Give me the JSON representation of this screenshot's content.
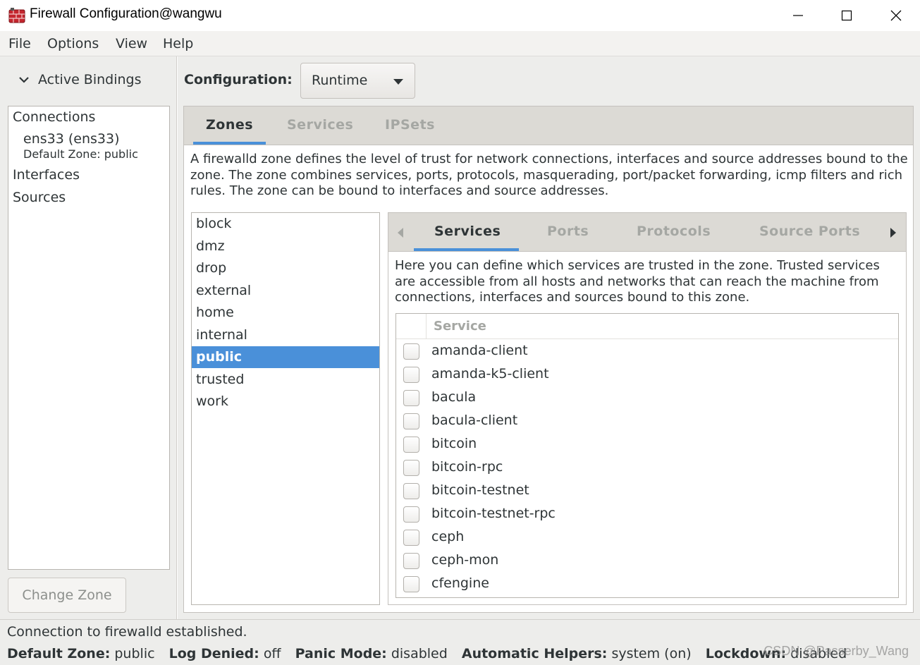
{
  "window": {
    "title": "Firewall Configuration@wangwu"
  },
  "menu": [
    "File",
    "Options",
    "View",
    "Help"
  ],
  "left": {
    "header": "Active Bindings",
    "connections_label": "Connections",
    "connection_name": "ens33 (ens33)",
    "connection_zone": "Default Zone: public",
    "interfaces_label": "Interfaces",
    "sources_label": "Sources",
    "change_zone_label": "Change Zone"
  },
  "config": {
    "label": "Configuration:",
    "value": "Runtime"
  },
  "tabs": [
    "Zones",
    "Services",
    "IPSets"
  ],
  "zone_description": "A firewalld zone defines the level of trust for network connections, interfaces and source addresses bound to the zone. The zone combines services, ports, protocols, masquerading, port/packet forwarding, icmp filters and rich rules. The zone can be bound to interfaces and source addresses.",
  "zones": [
    "block",
    "dmz",
    "drop",
    "external",
    "home",
    "internal",
    "public",
    "trusted",
    "work"
  ],
  "selected_zone": "public",
  "inner_tabs": [
    "Services",
    "Ports",
    "Protocols",
    "Source Ports"
  ],
  "services_description": "Here you can define which services are trusted in the zone. Trusted services are accessible from all hosts and networks that can reach the machine from connections, interfaces and sources bound to this zone.",
  "service_column": "Service",
  "services": [
    "amanda-client",
    "amanda-k5-client",
    "bacula",
    "bacula-client",
    "bitcoin",
    "bitcoin-rpc",
    "bitcoin-testnet",
    "bitcoin-testnet-rpc",
    "ceph",
    "ceph-mon",
    "cfengine"
  ],
  "status": {
    "message": "Connection to firewalld established.",
    "default_zone_label": "Default Zone:",
    "default_zone_value": "public",
    "log_denied_label": "Log Denied:",
    "log_denied_value": "off",
    "panic_mode_label": "Panic Mode:",
    "panic_mode_value": "disabled",
    "helpers_label": "Automatic Helpers:",
    "helpers_value": "system (on)",
    "lockdown_label": "Lockdown:",
    "lockdown_value": "disabled"
  },
  "watermark": "CSDN @Passerby_Wang",
  "colors": {
    "accent": "#4a90d9",
    "window_bg": "#ededeb",
    "tab_bg": "#dcdad5"
  }
}
